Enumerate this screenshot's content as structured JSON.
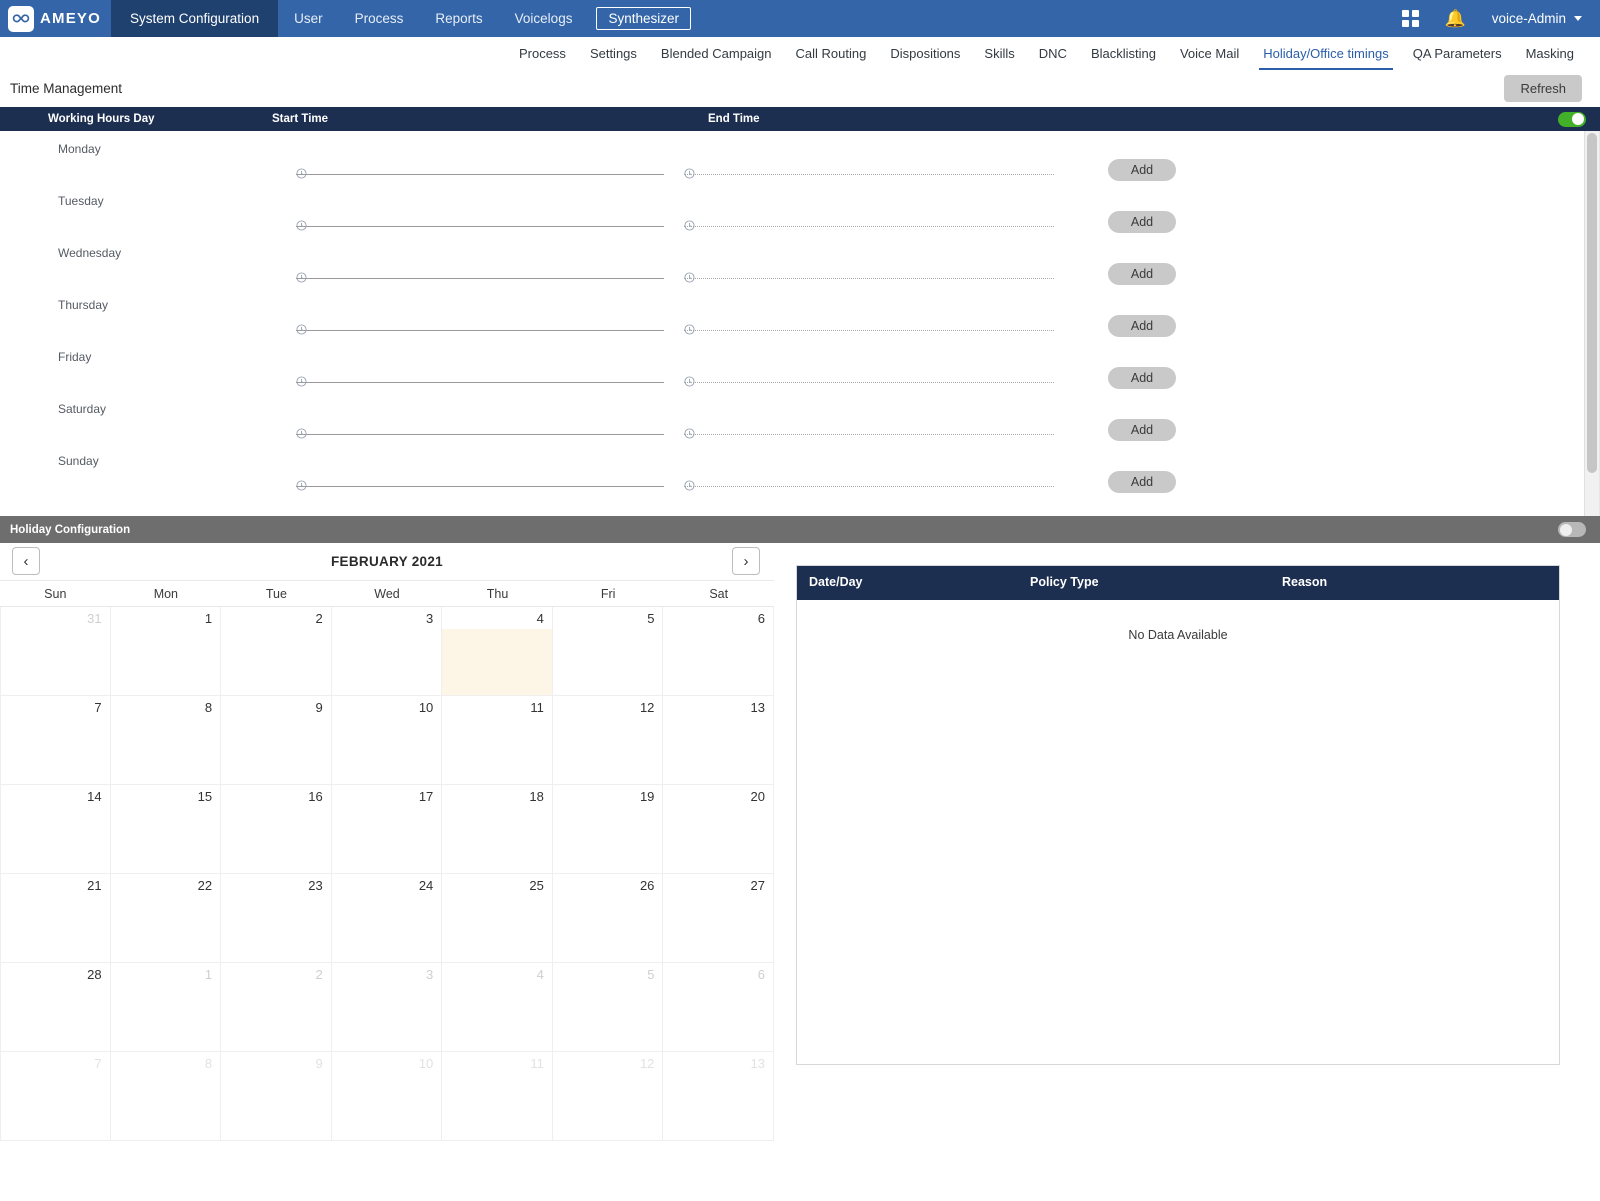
{
  "brand": {
    "logo_text": "AMEYO",
    "logo_icon": "infinity-icon"
  },
  "topnav": {
    "items": [
      {
        "label": "System Configuration",
        "active": true,
        "boxed": false
      },
      {
        "label": "User",
        "active": false,
        "boxed": false
      },
      {
        "label": "Process",
        "active": false,
        "boxed": false
      },
      {
        "label": "Reports",
        "active": false,
        "boxed": false
      },
      {
        "label": "Voicelogs",
        "active": false,
        "boxed": false
      },
      {
        "label": "Synthesizer",
        "active": false,
        "boxed": true
      }
    ],
    "apps_icon": "grid-apps-icon",
    "notifications_icon": "bell-icon",
    "user": "voice-Admin",
    "user_caret_icon": "chevron-down-icon"
  },
  "subnav": {
    "items": [
      {
        "label": "Process",
        "active": false
      },
      {
        "label": "Settings",
        "active": false
      },
      {
        "label": "Blended Campaign",
        "active": false
      },
      {
        "label": "Call Routing",
        "active": false
      },
      {
        "label": "Dispositions",
        "active": false
      },
      {
        "label": "Skills",
        "active": false
      },
      {
        "label": "DNC",
        "active": false
      },
      {
        "label": "Blacklisting",
        "active": false
      },
      {
        "label": "Voice Mail",
        "active": false
      },
      {
        "label": "Holiday/Office timings",
        "active": true
      },
      {
        "label": "QA Parameters",
        "active": false
      },
      {
        "label": "Masking",
        "active": false
      }
    ]
  },
  "page": {
    "title": "Time Management",
    "refresh_label": "Refresh"
  },
  "time_management": {
    "columns": {
      "day": "Working Hours Day",
      "start": "Start Time",
      "end": "End Time"
    },
    "enabled": true,
    "add_label": "Add",
    "start_icon": "clock-icon",
    "end_icon": "clock-icon",
    "rows": [
      {
        "day": "Monday",
        "start": "",
        "end": ""
      },
      {
        "day": "Tuesday",
        "start": "",
        "end": ""
      },
      {
        "day": "Wednesday",
        "start": "",
        "end": ""
      },
      {
        "day": "Thursday",
        "start": "",
        "end": ""
      },
      {
        "day": "Friday",
        "start": "",
        "end": ""
      },
      {
        "day": "Saturday",
        "start": "",
        "end": ""
      },
      {
        "day": "Sunday",
        "start": "",
        "end": ""
      }
    ]
  },
  "holiday_configuration": {
    "title": "Holiday Configuration",
    "enabled": false
  },
  "calendar": {
    "month_label": "FEBRUARY 2021",
    "prev_icon": "chevron-left-icon",
    "next_icon": "chevron-right-icon",
    "dow": [
      "Sun",
      "Mon",
      "Tue",
      "Wed",
      "Thu",
      "Fri",
      "Sat"
    ],
    "highlight_color": "#fdf5e6",
    "weeks": [
      [
        {
          "n": "31",
          "state": "muted"
        },
        {
          "n": "1",
          "state": "in"
        },
        {
          "n": "2",
          "state": "in"
        },
        {
          "n": "3",
          "state": "in"
        },
        {
          "n": "4",
          "state": "in",
          "highlight": true
        },
        {
          "n": "5",
          "state": "in"
        },
        {
          "n": "6",
          "state": "in"
        }
      ],
      [
        {
          "n": "7",
          "state": "in"
        },
        {
          "n": "8",
          "state": "in"
        },
        {
          "n": "9",
          "state": "in"
        },
        {
          "n": "10",
          "state": "in"
        },
        {
          "n": "11",
          "state": "in"
        },
        {
          "n": "12",
          "state": "in"
        },
        {
          "n": "13",
          "state": "in"
        }
      ],
      [
        {
          "n": "14",
          "state": "in"
        },
        {
          "n": "15",
          "state": "in"
        },
        {
          "n": "16",
          "state": "in"
        },
        {
          "n": "17",
          "state": "in"
        },
        {
          "n": "18",
          "state": "in"
        },
        {
          "n": "19",
          "state": "in"
        },
        {
          "n": "20",
          "state": "in"
        }
      ],
      [
        {
          "n": "21",
          "state": "in"
        },
        {
          "n": "22",
          "state": "in"
        },
        {
          "n": "23",
          "state": "in"
        },
        {
          "n": "24",
          "state": "in"
        },
        {
          "n": "25",
          "state": "in"
        },
        {
          "n": "26",
          "state": "in"
        },
        {
          "n": "27",
          "state": "in"
        }
      ],
      [
        {
          "n": "28",
          "state": "in"
        },
        {
          "n": "1",
          "state": "muted"
        },
        {
          "n": "2",
          "state": "muted"
        },
        {
          "n": "3",
          "state": "muted"
        },
        {
          "n": "4",
          "state": "muted"
        },
        {
          "n": "5",
          "state": "muted"
        },
        {
          "n": "6",
          "state": "muted"
        }
      ],
      [
        {
          "n": "7",
          "state": "faint"
        },
        {
          "n": "8",
          "state": "faint"
        },
        {
          "n": "9",
          "state": "faint"
        },
        {
          "n": "10",
          "state": "faint"
        },
        {
          "n": "11",
          "state": "faint"
        },
        {
          "n": "12",
          "state": "faint"
        },
        {
          "n": "13",
          "state": "faint"
        }
      ]
    ]
  },
  "holiday_table": {
    "columns": [
      "Date/Day",
      "Policy Type",
      "Reason"
    ],
    "empty_message": "No Data Available",
    "rows": []
  },
  "colors": {
    "brand_blue": "#3365a8",
    "nav_active": "#1f4170",
    "header_navy": "#1d2f50",
    "toggle_on": "#43b02a",
    "accent_link": "#2b5ea8",
    "holiday_bar": "#6e6e6e"
  }
}
